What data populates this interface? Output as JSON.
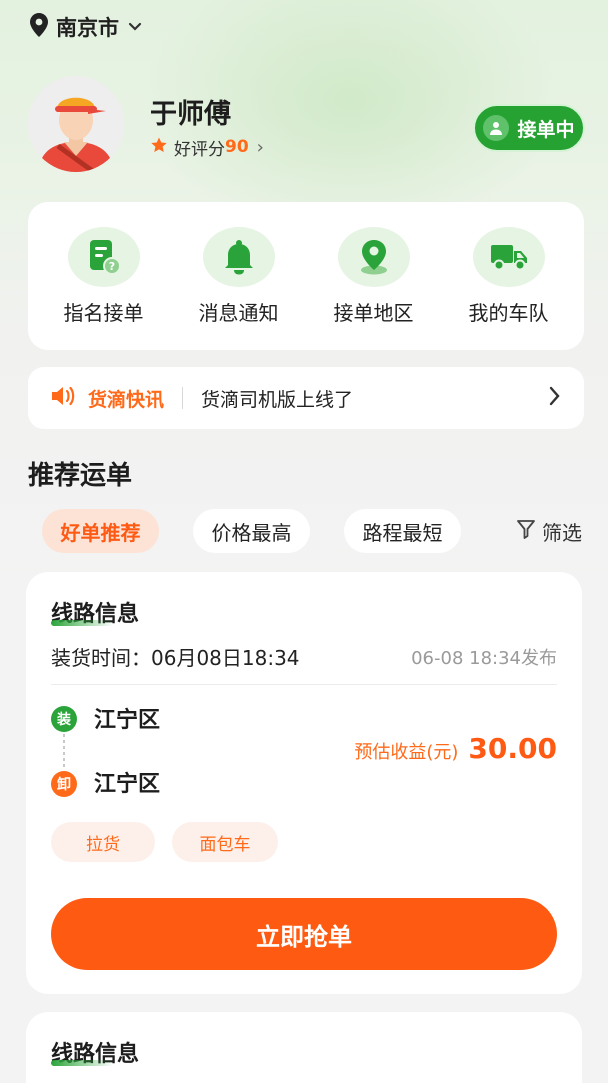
{
  "location": {
    "city": "南京市",
    "icon": "map-pin-icon"
  },
  "profile": {
    "name": "于师傅",
    "rating_label": "好评分",
    "rating_value": "90",
    "chevron": "›"
  },
  "status_button": {
    "label": "接单中",
    "icon": "driver-icon"
  },
  "quick_actions": [
    {
      "label": "指名接单",
      "icon": "order-request-icon"
    },
    {
      "label": "消息通知",
      "icon": "bell-icon"
    },
    {
      "label": "接单地区",
      "icon": "location-pin-icon"
    },
    {
      "label": "我的车队",
      "icon": "truck-icon"
    }
  ],
  "news": {
    "tag": "货滴快讯",
    "message": "货滴司机版上线了",
    "icon": "speaker-icon",
    "chevron": "›"
  },
  "section_title": "推荐运单",
  "filters": {
    "options": [
      "好单推荐",
      "价格最高",
      "路程最短"
    ],
    "active_index": 0,
    "filter_label": "筛选"
  },
  "orders": [
    {
      "title": "线路信息",
      "load_time_label": "装货时间：",
      "load_time": "06月08日18:34",
      "published": "06-08 18:34发布",
      "load_badge": "装",
      "unload_badge": "卸",
      "load_place": "江宁区",
      "unload_place": "江宁区",
      "earnings_label": "预估收益(元)",
      "earnings_value": "30.00",
      "tags": [
        "拉货",
        "面包车"
      ],
      "action_label": "立即抢单"
    },
    {
      "title": "线路信息"
    }
  ],
  "colors": {
    "brand_green": "#26a232",
    "accent_orange": "#ff5a12",
    "card_bg": "#ffffff",
    "page_bg": "#f3f3f3"
  }
}
